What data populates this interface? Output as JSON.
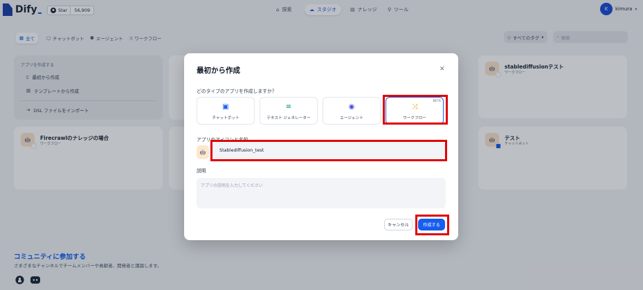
{
  "header": {
    "logo_text": "Dify",
    "github": {
      "label": "Star",
      "count": "56,909"
    },
    "nav": [
      {
        "label": "探索",
        "icon": "compass-icon"
      },
      {
        "label": "スタジオ",
        "icon": "studio-icon"
      },
      {
        "label": "ナレッジ",
        "icon": "book-icon"
      },
      {
        "label": "ツール",
        "icon": "tool-icon"
      }
    ],
    "user": {
      "initial": "K",
      "name": "kimura"
    }
  },
  "filters": {
    "tabs": [
      {
        "label": "全て",
        "active": true
      },
      {
        "label": "チャットボット"
      },
      {
        "label": "エージェント"
      },
      {
        "label": "ワークフロー"
      }
    ],
    "tag_select": "すべてのタグ",
    "search_placeholder": "検索"
  },
  "create_card": {
    "title": "アプリを作成する",
    "items": [
      "最初から作成",
      "テンプレートから作成",
      "DSL ファイルをインポート"
    ]
  },
  "app_cards": [
    {
      "name": "stablediffusionテスト",
      "type": "ワークフロー"
    },
    {
      "name": "Firecrawlのナレッジの場合",
      "type": "ワークフロー"
    },
    {
      "name": "テスト",
      "type": "チャットボット"
    }
  ],
  "community": {
    "title": "コミュニティに参加する",
    "subtitle": "さまざまなチャンネルでチームメンバーや貢献者、開発者と議論します。"
  },
  "modal": {
    "title": "最初から作成",
    "question": "どのタイプのアプリを作成しますか？",
    "types": [
      {
        "label": "チャットボット",
        "icon": "chatbot-icon"
      },
      {
        "label": "テキスト ジェネレーター",
        "icon": "text-generator-icon"
      },
      {
        "label": "エージェント",
        "icon": "agent-icon"
      },
      {
        "label": "ワークフロー",
        "icon": "workflow-icon",
        "beta": "BETA"
      }
    ],
    "name_label": "アプリのアイコンと名前",
    "name_value": "Stablediffusion_test",
    "desc_label": "説明",
    "desc_placeholder": "アプリの説明を入力してください",
    "cancel": "キャンセル",
    "create": "作成する"
  },
  "colors": {
    "accent": "#155eef",
    "highlight": "#e00000",
    "brand": "#1c3fa8"
  }
}
